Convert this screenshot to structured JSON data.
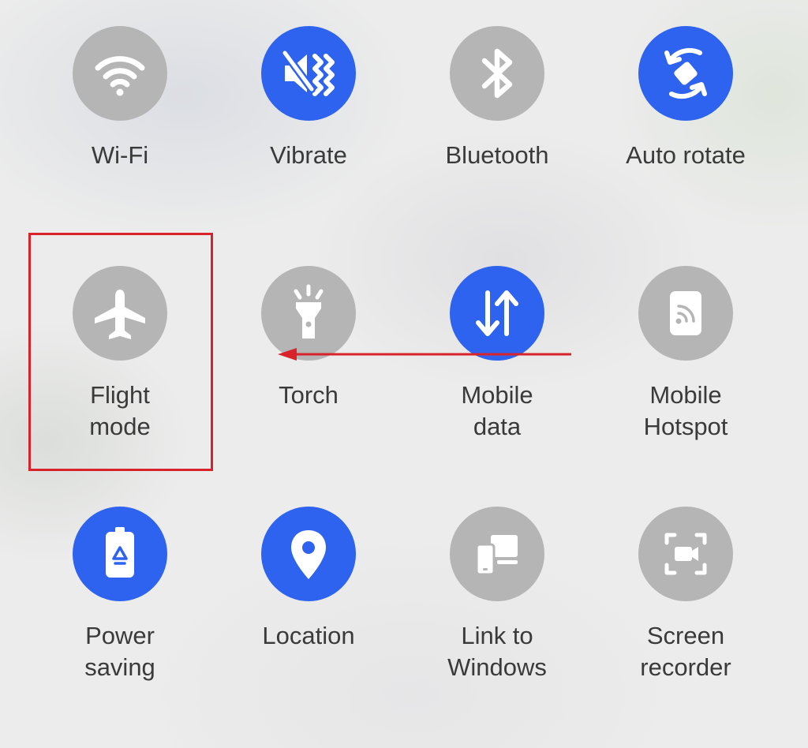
{
  "tiles": [
    {
      "label": "Wi-Fi",
      "icon": "wifi-icon",
      "state": "off"
    },
    {
      "label": "Vibrate",
      "icon": "vibrate-icon",
      "state": "on"
    },
    {
      "label": "Bluetooth",
      "icon": "bluetooth-icon",
      "state": "off"
    },
    {
      "label": "Auto rotate",
      "icon": "auto-rotate-icon",
      "state": "on"
    },
    {
      "label": "Flight\nmode",
      "icon": "airplane-icon",
      "state": "off"
    },
    {
      "label": "Torch",
      "icon": "torch-icon",
      "state": "off"
    },
    {
      "label": "Mobile\ndata",
      "icon": "mobile-data-icon",
      "state": "on"
    },
    {
      "label": "Mobile\nHotspot",
      "icon": "hotspot-icon",
      "state": "off"
    },
    {
      "label": "Power\nsaving",
      "icon": "power-saving-icon",
      "state": "on"
    },
    {
      "label": "Location",
      "icon": "location-pin-icon",
      "state": "on"
    },
    {
      "label": "Link to\nWindows",
      "icon": "link-to-windows-icon",
      "state": "off"
    },
    {
      "label": "Screen\nrecorder",
      "icon": "screen-recorder-icon",
      "state": "off"
    }
  ],
  "colors": {
    "active": "#2e63f0",
    "inactive": "#b5b5b5",
    "annotation": "#d8232a",
    "label_text": "#3a3a3a"
  },
  "annotations": {
    "highlight": "flight-mode-tile",
    "arrow": "swipe-left-arrow"
  }
}
